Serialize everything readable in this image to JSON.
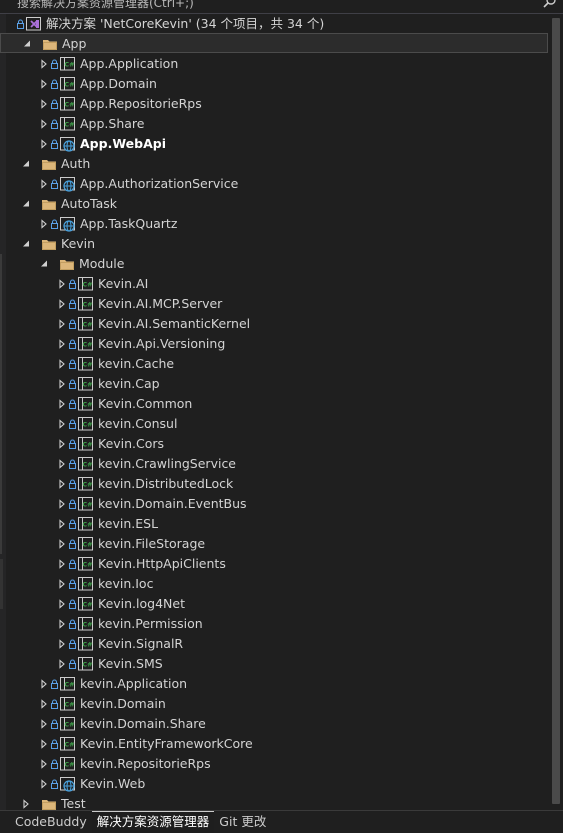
{
  "search": {
    "placeholder": "搜索解决方案资源管理器(Ctrl+;)"
  },
  "colors": {
    "folder": "#dcb67a",
    "csharp": "#3fa14a",
    "web": "#4aa3df",
    "solution": "#a970d9",
    "background": "#1f1f1f"
  },
  "tree": [
    {
      "label": "解决方案 'NetCoreKevin' (34 个项目，共 34 个)",
      "icon": "solution-icon",
      "chev": "none",
      "lock": true,
      "level": 0,
      "name": "solution-node"
    },
    {
      "label": "App",
      "icon": "folder-icon",
      "chev": "expanded",
      "lock": false,
      "level": 1,
      "selected": true,
      "name": "tree-folder-app"
    },
    {
      "label": "App.Application",
      "icon": "csharp-project-icon",
      "chev": "collapsed",
      "lock": true,
      "level": 2,
      "name": "tree-project"
    },
    {
      "label": "App.Domain",
      "icon": "csharp-project-icon",
      "chev": "collapsed",
      "lock": true,
      "level": 2,
      "name": "tree-project"
    },
    {
      "label": "App.RepositorieRps",
      "icon": "csharp-project-icon",
      "chev": "collapsed",
      "lock": true,
      "level": 2,
      "name": "tree-project"
    },
    {
      "label": "App.Share",
      "icon": "csharp-project-icon",
      "chev": "collapsed",
      "lock": true,
      "level": 2,
      "name": "tree-project"
    },
    {
      "label": "App.WebApi",
      "icon": "web-project-icon",
      "chev": "collapsed",
      "lock": true,
      "level": 2,
      "bold": true,
      "name": "tree-project-startup"
    },
    {
      "label": "Auth",
      "icon": "folder-icon",
      "chev": "expanded",
      "lock": false,
      "level": 1,
      "name": "tree-folder-auth"
    },
    {
      "label": "App.AuthorizationService",
      "icon": "web-project-icon",
      "chev": "collapsed",
      "lock": true,
      "level": 2,
      "name": "tree-project"
    },
    {
      "label": "AutoTask",
      "icon": "folder-icon",
      "chev": "expanded",
      "lock": false,
      "level": 1,
      "name": "tree-folder-autotask"
    },
    {
      "label": "App.TaskQuartz",
      "icon": "web-project-icon",
      "chev": "collapsed",
      "lock": true,
      "level": 2,
      "name": "tree-project"
    },
    {
      "label": "Kevin",
      "icon": "folder-icon",
      "chev": "expanded",
      "lock": false,
      "level": 1,
      "name": "tree-folder-kevin"
    },
    {
      "label": "Module",
      "icon": "folder-icon",
      "chev": "expanded",
      "lock": false,
      "level": 2,
      "name": "tree-folder-module"
    },
    {
      "label": "Kevin.AI",
      "icon": "csharp-project-icon",
      "chev": "collapsed",
      "lock": true,
      "level": 3,
      "name": "tree-project"
    },
    {
      "label": "Kevin.AI.MCP.Server",
      "icon": "csharp-project-icon",
      "chev": "collapsed",
      "lock": true,
      "level": 3,
      "name": "tree-project"
    },
    {
      "label": "Kevin.AI.SemanticKernel",
      "icon": "csharp-project-icon",
      "chev": "collapsed",
      "lock": true,
      "level": 3,
      "name": "tree-project"
    },
    {
      "label": "Kevin.Api.Versioning",
      "icon": "csharp-project-icon",
      "chev": "collapsed",
      "lock": true,
      "level": 3,
      "name": "tree-project"
    },
    {
      "label": "kevin.Cache",
      "icon": "csharp-project-icon",
      "chev": "collapsed",
      "lock": true,
      "level": 3,
      "name": "tree-project"
    },
    {
      "label": "kevin.Cap",
      "icon": "csharp-project-icon",
      "chev": "collapsed",
      "lock": true,
      "level": 3,
      "name": "tree-project"
    },
    {
      "label": "Kevin.Common",
      "icon": "csharp-project-icon",
      "chev": "collapsed",
      "lock": true,
      "level": 3,
      "name": "tree-project"
    },
    {
      "label": "kevin.Consul",
      "icon": "csharp-project-icon",
      "chev": "collapsed",
      "lock": true,
      "level": 3,
      "name": "tree-project"
    },
    {
      "label": "Kevin.Cors",
      "icon": "csharp-project-icon",
      "chev": "collapsed",
      "lock": true,
      "level": 3,
      "name": "tree-project"
    },
    {
      "label": "kevin.CrawlingService",
      "icon": "csharp-project-icon",
      "chev": "collapsed",
      "lock": true,
      "level": 3,
      "name": "tree-project"
    },
    {
      "label": "kevin.DistributedLock",
      "icon": "csharp-project-icon",
      "chev": "collapsed",
      "lock": true,
      "level": 3,
      "name": "tree-project"
    },
    {
      "label": "kevin.Domain.EventBus",
      "icon": "csharp-project-icon",
      "chev": "collapsed",
      "lock": true,
      "level": 3,
      "name": "tree-project"
    },
    {
      "label": "kevin.ESL",
      "icon": "csharp-project-icon",
      "chev": "collapsed",
      "lock": true,
      "level": 3,
      "name": "tree-project"
    },
    {
      "label": "kevin.FileStorage",
      "icon": "csharp-project-icon",
      "chev": "collapsed",
      "lock": true,
      "level": 3,
      "name": "tree-project"
    },
    {
      "label": "Kevin.HttpApiClients",
      "icon": "csharp-project-icon",
      "chev": "collapsed",
      "lock": true,
      "level": 3,
      "name": "tree-project"
    },
    {
      "label": "kevin.Ioc",
      "icon": "csharp-project-icon",
      "chev": "collapsed",
      "lock": true,
      "level": 3,
      "name": "tree-project"
    },
    {
      "label": "Kevin.log4Net",
      "icon": "csharp-project-icon",
      "chev": "collapsed",
      "lock": true,
      "level": 3,
      "name": "tree-project"
    },
    {
      "label": "kevin.Permission",
      "icon": "csharp-project-icon",
      "chev": "collapsed",
      "lock": true,
      "level": 3,
      "name": "tree-project"
    },
    {
      "label": "Kevin.SignalR",
      "icon": "csharp-project-icon",
      "chev": "collapsed",
      "lock": true,
      "level": 3,
      "name": "tree-project"
    },
    {
      "label": "Kevin.SMS",
      "icon": "csharp-project-icon",
      "chev": "collapsed",
      "lock": true,
      "level": 3,
      "name": "tree-project"
    },
    {
      "label": "kevin.Application",
      "icon": "csharp-project-icon",
      "chev": "collapsed",
      "lock": true,
      "level": 2,
      "name": "tree-project"
    },
    {
      "label": "kevin.Domain",
      "icon": "csharp-project-icon",
      "chev": "collapsed",
      "lock": true,
      "level": 2,
      "name": "tree-project"
    },
    {
      "label": "kevin.Domain.Share",
      "icon": "csharp-project-icon",
      "chev": "collapsed",
      "lock": true,
      "level": 2,
      "name": "tree-project"
    },
    {
      "label": "Kevin.EntityFrameworkCore",
      "icon": "csharp-project-icon",
      "chev": "collapsed",
      "lock": true,
      "level": 2,
      "name": "tree-project"
    },
    {
      "label": "kevin.RepositorieRps",
      "icon": "csharp-project-icon",
      "chev": "collapsed",
      "lock": true,
      "level": 2,
      "name": "tree-project"
    },
    {
      "label": "Kevin.Web",
      "icon": "web-project-icon",
      "chev": "collapsed",
      "lock": true,
      "level": 2,
      "name": "tree-project"
    },
    {
      "label": "Test",
      "icon": "folder-icon",
      "chev": "collapsed",
      "lock": false,
      "level": 1,
      "name": "tree-folder-test"
    }
  ],
  "tabs": [
    {
      "label": "CodeBuddy",
      "active": false
    },
    {
      "label": "解决方案资源管理器",
      "active": true
    },
    {
      "label": "Git 更改",
      "active": false
    }
  ]
}
